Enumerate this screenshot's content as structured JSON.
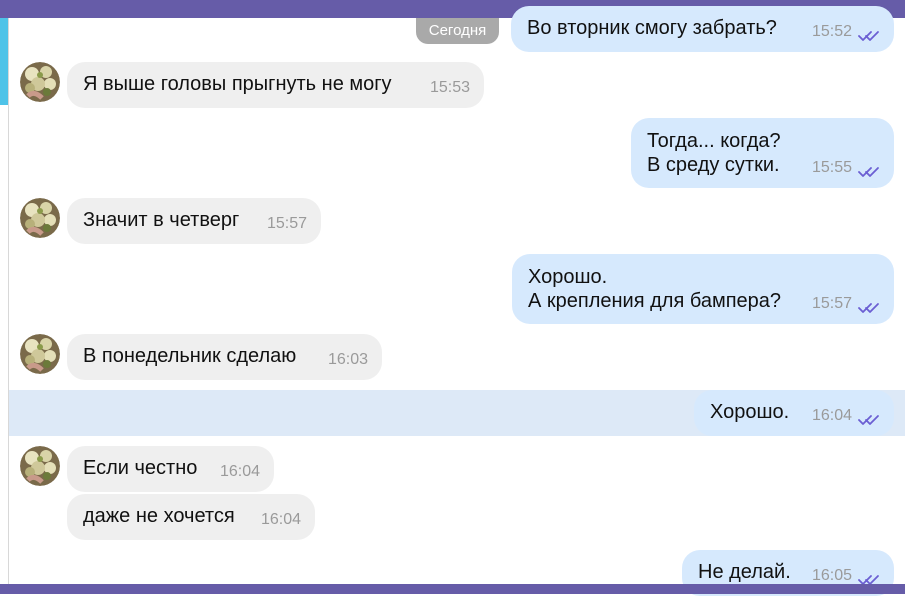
{
  "date_chip": "Сегодня",
  "colors": {
    "header": "#665ca8",
    "incoming_bubble": "#efefef",
    "outgoing_bubble": "#d6e9fd",
    "highlight_row": "#dde9f7",
    "read_ticks": "#6b5fd3"
  },
  "messages": [
    {
      "direction": "out",
      "lines": [
        "Во вторник смогу забрать?"
      ],
      "time": "15:52",
      "status": "read"
    },
    {
      "direction": "in",
      "lines": [
        "Я выше головы прыгнуть не могу"
      ],
      "time": "15:53"
    },
    {
      "direction": "out",
      "lines": [
        "Тогда... когда?",
        "В среду сутки."
      ],
      "time": "15:55",
      "status": "read"
    },
    {
      "direction": "in",
      "lines": [
        "Значит в четверг"
      ],
      "time": "15:57"
    },
    {
      "direction": "out",
      "lines": [
        "Хорошо.",
        "А крепления для бампера?"
      ],
      "time": "15:57",
      "status": "read"
    },
    {
      "direction": "in",
      "lines": [
        "В понедельник сделаю"
      ],
      "time": "16:03"
    },
    {
      "direction": "out",
      "lines": [
        "Хорошо."
      ],
      "time": "16:04",
      "status": "read"
    },
    {
      "direction": "in",
      "lines": [
        "Если честно"
      ],
      "time": "16:04"
    },
    {
      "direction": "in",
      "lines": [
        "даже не хочется"
      ],
      "time": "16:04"
    },
    {
      "direction": "out",
      "lines": [
        "Не делай."
      ],
      "time": "16:05",
      "status": "read"
    }
  ]
}
